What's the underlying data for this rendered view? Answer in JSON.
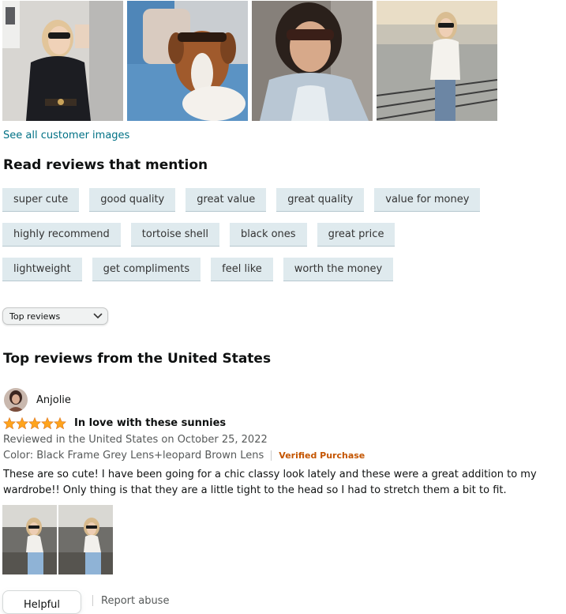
{
  "gallery": {
    "see_all_label": "See all customer images"
  },
  "mentions": {
    "title": "Read reviews that mention",
    "rows": [
      [
        "super cute",
        "good quality",
        "great value",
        "great quality",
        "value for money"
      ],
      [
        "highly recommend",
        "tortoise shell",
        "black ones",
        "great price"
      ],
      [
        "lightweight",
        "get compliments",
        "feel like",
        "worth the money"
      ]
    ]
  },
  "sort": {
    "selected": "Top reviews"
  },
  "reviews_section": {
    "title": "Top reviews from the United States"
  },
  "review": {
    "reviewer_name": "Anjolie",
    "rating": 5,
    "title": "In love with these sunnies",
    "date_line": "Reviewed in the United States on October 25, 2022",
    "variant": "Color: Black Frame Grey Lens+leopard Brown Lens",
    "verified": "Verified Purchase",
    "body": "These are so cute! I have been going for a chic classy look lately and these were a great addition to my wardrobe!! Only thing is that they are a little tight to the head so I had to stretch them a bit to fit.",
    "helpful_label": "Helpful",
    "report_label": "Report abuse"
  },
  "colors": {
    "link": "#007185",
    "star": "#ffa41c",
    "verified": "#c45500",
    "chip_bg": "#dfeaee"
  }
}
